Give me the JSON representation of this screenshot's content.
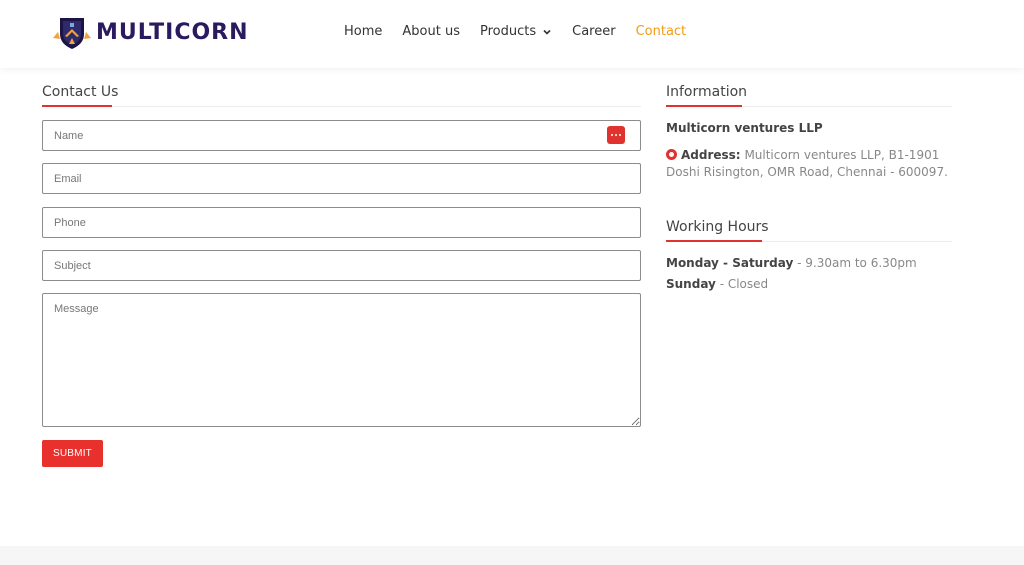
{
  "brand": {
    "name": "MULTICORN",
    "accent": "#e0322f",
    "nav_active": "#f39c12"
  },
  "nav": {
    "items": [
      {
        "label": "Home"
      },
      {
        "label": "About us"
      },
      {
        "label": "Products"
      },
      {
        "label": "Career"
      },
      {
        "label": "Contact",
        "active": true
      }
    ]
  },
  "contact": {
    "title": "Contact Us",
    "fields": {
      "name_placeholder": "Name",
      "email_placeholder": "Email",
      "phone_placeholder": "Phone",
      "subject_placeholder": "Subject",
      "message_placeholder": "Message"
    },
    "submit_label": "SUBMIT"
  },
  "information": {
    "title": "Information",
    "company": "Multicorn ventures LLP",
    "address_label": "Address:",
    "address_value": "Multicorn ventures LLP, B1-1901 Doshi Risington, OMR Road, Chennai - 600097.",
    "icons": {
      "address": "map-pin-icon"
    }
  },
  "working_hours": {
    "title": "Working Hours",
    "rows": [
      {
        "days": "Monday - Saturday",
        "time": "- 9.30am to 6.30pm"
      },
      {
        "days": "Sunday",
        "time": "- Closed"
      }
    ]
  }
}
